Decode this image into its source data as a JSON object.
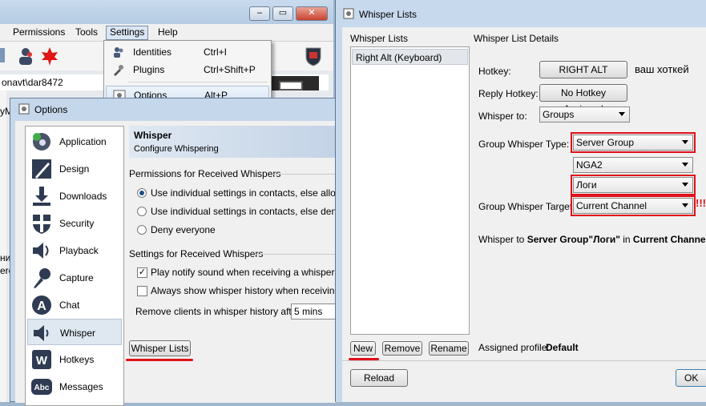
{
  "main_window": {
    "menu": [
      "Permissions",
      "Tools",
      "Settings",
      "Help"
    ],
    "address": "onavt\\dar8472",
    "side_text": "yM",
    "side_cut": [
      "ни",
      "ere"
    ]
  },
  "settings_menu": {
    "items": [
      {
        "label": "Identities",
        "shortcut": "Ctrl+I",
        "icon": "identities-icon"
      },
      {
        "label": "Plugins",
        "shortcut": "Ctrl+Shift+P",
        "icon": "plugins-icon"
      },
      {
        "label": "Options",
        "shortcut": "Alt+P",
        "icon": "options-icon"
      }
    ]
  },
  "options": {
    "title": "Options",
    "nav": [
      {
        "label": "Application",
        "icon": "application-icon"
      },
      {
        "label": "Design",
        "icon": "design-icon"
      },
      {
        "label": "Downloads",
        "icon": "downloads-icon"
      },
      {
        "label": "Security",
        "icon": "security-icon"
      },
      {
        "label": "Playback",
        "icon": "playback-icon"
      },
      {
        "label": "Capture",
        "icon": "capture-icon"
      },
      {
        "label": "Chat",
        "icon": "chat-icon"
      },
      {
        "label": "Whisper",
        "icon": "whisper-icon"
      },
      {
        "label": "Hotkeys",
        "icon": "hotkeys-icon"
      },
      {
        "label": "Messages",
        "icon": "messages-icon"
      }
    ],
    "selected": "Whisper",
    "header_title": "Whisper",
    "header_subtitle": "Configure Whispering",
    "group1_title": "Permissions for Received Whispers",
    "radios": [
      {
        "label": "Use individual settings in contacts, else allow",
        "checked": true
      },
      {
        "label": "Use individual settings in contacts, else deny",
        "checked": false
      },
      {
        "label": "Deny everyone",
        "checked": false
      }
    ],
    "group2_title": "Settings for Received Whispers",
    "checks": [
      {
        "label": "Play notify sound when receiving a whisper",
        "checked": true
      },
      {
        "label": "Always show whisper history when receiving a w",
        "checked": false
      }
    ],
    "remove_label": "Remove clients in whisper history after",
    "remove_value": "5 mins",
    "whisper_lists_button": "Whisper Lists"
  },
  "whisper_lists": {
    "title": "Whisper Lists",
    "list_title": "Whisper Lists",
    "items": [
      "Right Alt (Keyboard)"
    ],
    "details_title": "Whisper List Details",
    "hotkey_label": "Hotkey:",
    "hotkey_value": "RIGHT ALT",
    "hotkey_note": "ваш хоткей",
    "reply_label": "Reply Hotkey:",
    "reply_value": "No Hotkey Assigned",
    "whisper_to_label": "Whisper to:",
    "whisper_to_value": "Groups",
    "group_type_label": "Group Whisper Type:",
    "group_type_value": "Server Group",
    "server_group_value": "NGA2",
    "group_name_value": "Логи",
    "target_label": "Group Whisper Target:",
    "target_value": "Current Channel",
    "exclaim": "!!!",
    "summary_prefix": "Whisper to ",
    "summary_group": "Server Group\"Логи\"",
    "summary_mid": " in ",
    "summary_target": "Current Channel",
    "btn_new": "New",
    "btn_remove": "Remove",
    "btn_rename": "Rename",
    "assigned_label": "Assigned profile:",
    "assigned_value": "Default",
    "btn_reload": "Reload",
    "btn_ok": "OK"
  },
  "colors": {
    "highlight_red": "#e0101a",
    "accent_blue": "#1a4f8c"
  }
}
